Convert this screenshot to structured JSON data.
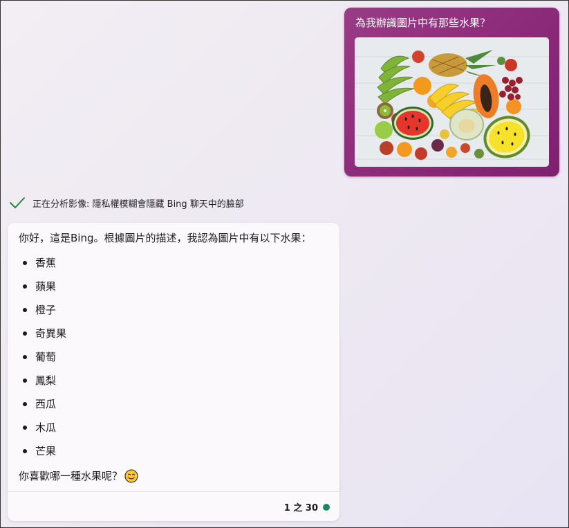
{
  "user_message": {
    "text": "為我辦識圖片中有那些水果？",
    "image_icon": "fruit-photo"
  },
  "status": {
    "icon": "check-icon",
    "text": "正在分析影像: 隱私權模糊會隱藏 Bing 聊天中的臉部",
    "color": "#1a8a3c"
  },
  "bot_response": {
    "intro": "你好，這是Bing。根據圖片的描述，我認為圖片中有以下水果：",
    "fruits": [
      "香蕉",
      "蘋果",
      "橙子",
      "奇異果",
      "葡萄",
      "鳳梨",
      "西瓜",
      "木瓜",
      "芒果"
    ],
    "question": "你喜歡哪一種水果呢？",
    "emoji_icon": "smile-emoji-icon",
    "turn_counter": "1 之 30",
    "turn_status_color": "#1a8a5a"
  },
  "colors": {
    "user_bubble": "#8a2a78",
    "bot_card": "#fbf9fc",
    "page_background": "#efeaf3"
  }
}
